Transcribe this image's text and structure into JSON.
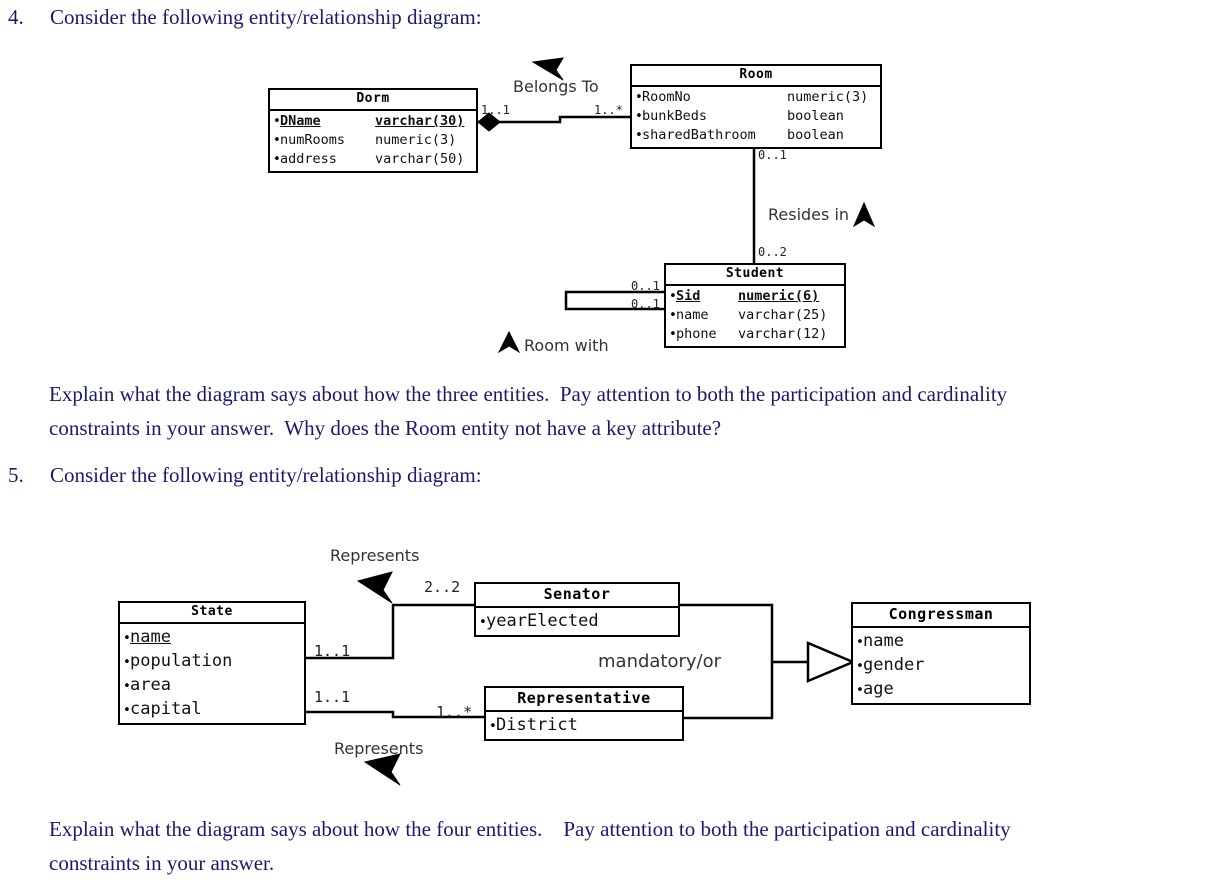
{
  "document": {
    "questions": [
      {
        "number": "4.",
        "prompt": "Consider the following entity/relationship diagram:",
        "explain_lines": [
          "Explain what the diagram says about how the three entities.  Pay attention to both the participation and cardinality",
          "constraints in your answer.  Why does the Room entity not have a key attribute?"
        ]
      },
      {
        "number": "5.",
        "prompt": "Consider the following entity/relationship diagram:",
        "explain_lines": [
          "Explain what the diagram says about how the four entities.    Pay attention to both the participation and cardinality",
          "constraints in your answer."
        ]
      }
    ]
  },
  "diagram4": {
    "entities": [
      {
        "name": "Dorm",
        "attributes": [
          {
            "name": "DName",
            "type": "varchar(30)",
            "key": true
          },
          {
            "name": "numRooms",
            "type": "numeric(3)",
            "key": false
          },
          {
            "name": "address",
            "type": "varchar(50)",
            "key": false
          }
        ]
      },
      {
        "name": "Room",
        "attributes": [
          {
            "name": "RoomNo",
            "type": "numeric(3)",
            "key": false
          },
          {
            "name": "bunkBeds",
            "type": "boolean",
            "key": false
          },
          {
            "name": "sharedBathroom",
            "type": "boolean",
            "key": false
          }
        ]
      },
      {
        "name": "Student",
        "attributes": [
          {
            "name": "Sid",
            "type": "numeric(6)",
            "key": true
          },
          {
            "name": "name",
            "type": "varchar(25)",
            "key": false
          },
          {
            "name": "phone",
            "type": "varchar(12)",
            "key": false
          }
        ]
      }
    ],
    "relationships": [
      {
        "label": "Belongs To",
        "from_cardinality": "1..1",
        "to_cardinality": "1..*",
        "decoration": "filled-diamond"
      },
      {
        "label": "Resides in",
        "from_cardinality": "0..1",
        "to_cardinality": "0..2",
        "decoration": "solid-arrow"
      },
      {
        "label": "Room with",
        "from_cardinality": "0..1",
        "to_cardinality": "0..1",
        "decoration": "solid-arrow"
      }
    ]
  },
  "diagram5": {
    "entities": [
      {
        "name": "State",
        "attributes": [
          {
            "name": "name",
            "type": "",
            "key": true
          },
          {
            "name": "population",
            "type": "",
            "key": false
          },
          {
            "name": "area",
            "type": "",
            "key": false
          },
          {
            "name": "capital",
            "type": "",
            "key": false
          }
        ]
      },
      {
        "name": "Senator",
        "attributes": [
          {
            "name": "yearElected",
            "type": "",
            "key": false
          }
        ]
      },
      {
        "name": "Representative",
        "attributes": [
          {
            "name": "District",
            "type": "",
            "key": false
          }
        ]
      },
      {
        "name": "Congressman",
        "attributes": [
          {
            "name": "name",
            "type": "",
            "key": false
          },
          {
            "name": "gender",
            "type": "",
            "key": false
          },
          {
            "name": "age",
            "type": "",
            "key": false
          }
        ]
      }
    ],
    "relationships": [
      {
        "label": "Represents",
        "state_cardinality": "1..1",
        "other_cardinality": "2..2",
        "decoration": "solid-arrow"
      },
      {
        "label": "Represents",
        "state_cardinality": "1..1",
        "other_cardinality": "1..*",
        "decoration": "solid-arrow"
      },
      {
        "label": "mandatory/or",
        "state_cardinality": "",
        "other_cardinality": "",
        "decoration": "hollow-triangle"
      }
    ]
  },
  "colors": {
    "text_navy": "#1a1a6e",
    "diagram_black": "#000000"
  }
}
